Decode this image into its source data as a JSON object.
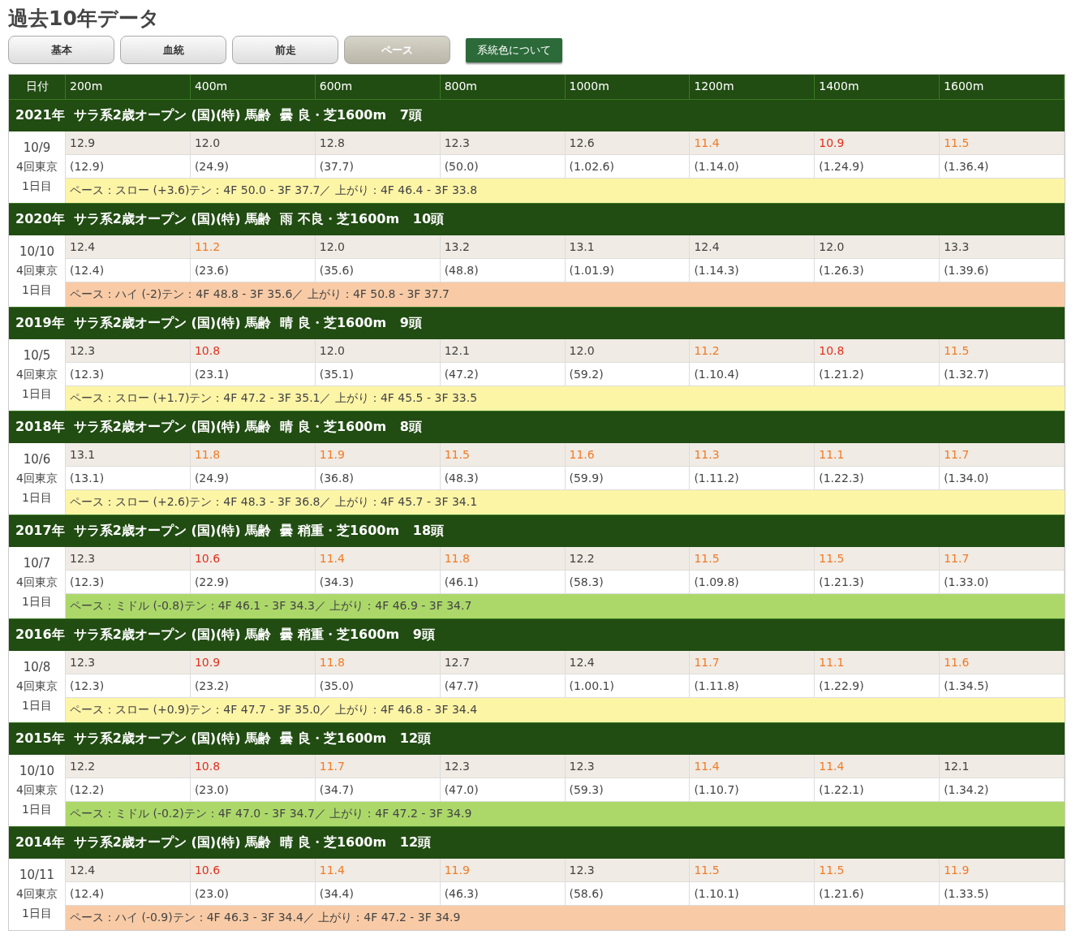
{
  "title": "過去10年データ",
  "tabs": [
    {
      "label": "基本",
      "selected": false
    },
    {
      "label": "血統",
      "selected": false
    },
    {
      "label": "前走",
      "selected": false
    },
    {
      "label": "ペース",
      "selected": true
    }
  ],
  "legend_button": "系統色について",
  "columns": [
    "日付",
    "200m",
    "400m",
    "600m",
    "800m",
    "1000m",
    "1200m",
    "1400m",
    "1600m"
  ],
  "races": [
    {
      "header": "2021年  サラ系2歳オープン (国)(特) 馬齢  曇 良・芝1600m   7頭",
      "date": "10/9",
      "meeting": "4回東京",
      "day": "1日目",
      "laps": [
        {
          "split": "12.9",
          "cum": "(12.9)",
          "color": "#444444"
        },
        {
          "split": "12.0",
          "cum": "(24.9)",
          "color": "#444444"
        },
        {
          "split": "12.8",
          "cum": "(37.7)",
          "color": "#444444"
        },
        {
          "split": "12.3",
          "cum": "(50.0)",
          "color": "#444444"
        },
        {
          "split": "12.6",
          "cum": "(1.02.6)",
          "color": "#444444"
        },
        {
          "split": "11.4",
          "cum": "(1.14.0)",
          "color": "#f07c28"
        },
        {
          "split": "10.9",
          "cum": "(1.24.9)",
          "color": "#e0301e"
        },
        {
          "split": "11.5",
          "cum": "(1.36.4)",
          "color": "#f07c28"
        }
      ],
      "pace": {
        "text": "ペース：スロー (+3.6)テン：4F 50.0 - 3F 37.7／ 上がり：4F 46.4 - 3F 33.8",
        "color": "#fdf5a6"
      }
    },
    {
      "header": "2020年  サラ系2歳オープン (国)(特) 馬齢  雨 不良・芝1600m   10頭",
      "date": "10/10",
      "meeting": "4回東京",
      "day": "1日目",
      "laps": [
        {
          "split": "12.4",
          "cum": "(12.4)",
          "color": "#444444"
        },
        {
          "split": "11.2",
          "cum": "(23.6)",
          "color": "#f07c28"
        },
        {
          "split": "12.0",
          "cum": "(35.6)",
          "color": "#444444"
        },
        {
          "split": "13.2",
          "cum": "(48.8)",
          "color": "#444444"
        },
        {
          "split": "13.1",
          "cum": "(1.01.9)",
          "color": "#444444"
        },
        {
          "split": "12.4",
          "cum": "(1.14.3)",
          "color": "#444444"
        },
        {
          "split": "12.0",
          "cum": "(1.26.3)",
          "color": "#444444"
        },
        {
          "split": "13.3",
          "cum": "(1.39.6)",
          "color": "#444444"
        }
      ],
      "pace": {
        "text": "ペース：ハイ (-2)テン：4F 48.8 - 3F 35.6／ 上がり：4F 50.8 - 3F 37.7",
        "color": "#f8cba6"
      }
    },
    {
      "header": "2019年  サラ系2歳オープン (国)(特) 馬齢  晴 良・芝1600m   9頭",
      "date": "10/5",
      "meeting": "4回東京",
      "day": "1日目",
      "laps": [
        {
          "split": "12.3",
          "cum": "(12.3)",
          "color": "#444444"
        },
        {
          "split": "10.8",
          "cum": "(23.1)",
          "color": "#e0301e"
        },
        {
          "split": "12.0",
          "cum": "(35.1)",
          "color": "#444444"
        },
        {
          "split": "12.1",
          "cum": "(47.2)",
          "color": "#444444"
        },
        {
          "split": "12.0",
          "cum": "(59.2)",
          "color": "#444444"
        },
        {
          "split": "11.2",
          "cum": "(1.10.4)",
          "color": "#f07c28"
        },
        {
          "split": "10.8",
          "cum": "(1.21.2)",
          "color": "#e0301e"
        },
        {
          "split": "11.5",
          "cum": "(1.32.7)",
          "color": "#f07c28"
        }
      ],
      "pace": {
        "text": "ペース：スロー (+1.7)テン：4F 47.2 - 3F 35.1／ 上がり：4F 45.5 - 3F 33.5",
        "color": "#fdf5a6"
      }
    },
    {
      "header": "2018年  サラ系2歳オープン (国)(特) 馬齢  晴 良・芝1600m   8頭",
      "date": "10/6",
      "meeting": "4回東京",
      "day": "1日目",
      "laps": [
        {
          "split": "13.1",
          "cum": "(13.1)",
          "color": "#444444"
        },
        {
          "split": "11.8",
          "cum": "(24.9)",
          "color": "#f07c28"
        },
        {
          "split": "11.9",
          "cum": "(36.8)",
          "color": "#f07c28"
        },
        {
          "split": "11.5",
          "cum": "(48.3)",
          "color": "#f07c28"
        },
        {
          "split": "11.6",
          "cum": "(59.9)",
          "color": "#f07c28"
        },
        {
          "split": "11.3",
          "cum": "(1.11.2)",
          "color": "#f07c28"
        },
        {
          "split": "11.1",
          "cum": "(1.22.3)",
          "color": "#f07c28"
        },
        {
          "split": "11.7",
          "cum": "(1.34.0)",
          "color": "#f07c28"
        }
      ],
      "pace": {
        "text": "ペース：スロー (+2.6)テン：4F 48.3 - 3F 36.8／ 上がり：4F 45.7 - 3F 34.1",
        "color": "#fdf5a6"
      }
    },
    {
      "header": "2017年  サラ系2歳オープン (国)(特) 馬齢  曇 稍重・芝1600m   18頭",
      "date": "10/7",
      "meeting": "4回東京",
      "day": "1日目",
      "laps": [
        {
          "split": "12.3",
          "cum": "(12.3)",
          "color": "#444444"
        },
        {
          "split": "10.6",
          "cum": "(22.9)",
          "color": "#e0301e"
        },
        {
          "split": "11.4",
          "cum": "(34.3)",
          "color": "#f07c28"
        },
        {
          "split": "11.8",
          "cum": "(46.1)",
          "color": "#f07c28"
        },
        {
          "split": "12.2",
          "cum": "(58.3)",
          "color": "#444444"
        },
        {
          "split": "11.5",
          "cum": "(1.09.8)",
          "color": "#f07c28"
        },
        {
          "split": "11.5",
          "cum": "(1.21.3)",
          "color": "#f07c28"
        },
        {
          "split": "11.7",
          "cum": "(1.33.0)",
          "color": "#f07c28"
        }
      ],
      "pace": {
        "text": "ペース：ミドル (-0.8)テン：4F 46.1 - 3F 34.3／ 上がり：4F 46.9 - 3F 34.7",
        "color": "#acd86a"
      }
    },
    {
      "header": "2016年  サラ系2歳オープン (国)(特) 馬齢  曇 稍重・芝1600m   9頭",
      "date": "10/8",
      "meeting": "4回東京",
      "day": "1日目",
      "laps": [
        {
          "split": "12.3",
          "cum": "(12.3)",
          "color": "#444444"
        },
        {
          "split": "10.9",
          "cum": "(23.2)",
          "color": "#e0301e"
        },
        {
          "split": "11.8",
          "cum": "(35.0)",
          "color": "#f07c28"
        },
        {
          "split": "12.7",
          "cum": "(47.7)",
          "color": "#444444"
        },
        {
          "split": "12.4",
          "cum": "(1.00.1)",
          "color": "#444444"
        },
        {
          "split": "11.7",
          "cum": "(1.11.8)",
          "color": "#f07c28"
        },
        {
          "split": "11.1",
          "cum": "(1.22.9)",
          "color": "#f07c28"
        },
        {
          "split": "11.6",
          "cum": "(1.34.5)",
          "color": "#f07c28"
        }
      ],
      "pace": {
        "text": "ペース：スロー (+0.9)テン：4F 47.7 - 3F 35.0／ 上がり：4F 46.8 - 3F 34.4",
        "color": "#fdf5a6"
      }
    },
    {
      "header": "2015年  サラ系2歳オープン (国)(特) 馬齢  曇 良・芝1600m   12頭",
      "date": "10/10",
      "meeting": "4回東京",
      "day": "1日目",
      "laps": [
        {
          "split": "12.2",
          "cum": "(12.2)",
          "color": "#444444"
        },
        {
          "split": "10.8",
          "cum": "(23.0)",
          "color": "#e0301e"
        },
        {
          "split": "11.7",
          "cum": "(34.7)",
          "color": "#f07c28"
        },
        {
          "split": "12.3",
          "cum": "(47.0)",
          "color": "#444444"
        },
        {
          "split": "12.3",
          "cum": "(59.3)",
          "color": "#444444"
        },
        {
          "split": "11.4",
          "cum": "(1.10.7)",
          "color": "#f07c28"
        },
        {
          "split": "11.4",
          "cum": "(1.22.1)",
          "color": "#f07c28"
        },
        {
          "split": "12.1",
          "cum": "(1.34.2)",
          "color": "#444444"
        }
      ],
      "pace": {
        "text": "ペース：ミドル (-0.2)テン：4F 47.0 - 3F 34.7／ 上がり：4F 47.2 - 3F 34.9",
        "color": "#acd86a"
      }
    },
    {
      "header": "2014年  サラ系2歳オープン (国)(特) 馬齢  晴 良・芝1600m   12頭",
      "date": "10/11",
      "meeting": "4回東京",
      "day": "1日目",
      "laps": [
        {
          "split": "12.4",
          "cum": "(12.4)",
          "color": "#444444"
        },
        {
          "split": "10.6",
          "cum": "(23.0)",
          "color": "#e0301e"
        },
        {
          "split": "11.4",
          "cum": "(34.4)",
          "color": "#f07c28"
        },
        {
          "split": "11.9",
          "cum": "(46.3)",
          "color": "#f07c28"
        },
        {
          "split": "12.3",
          "cum": "(58.6)",
          "color": "#444444"
        },
        {
          "split": "11.5",
          "cum": "(1.10.1)",
          "color": "#f07c28"
        },
        {
          "split": "11.5",
          "cum": "(1.21.6)",
          "color": "#f07c28"
        },
        {
          "split": "11.9",
          "cum": "(1.33.5)",
          "color": "#f07c28"
        }
      ],
      "pace": {
        "text": "ペース：ハイ (-0.9)テン：4F 46.3 - 3F 34.4／ 上がり：4F 47.2 - 3F 34.9",
        "color": "#f8cba6"
      }
    }
  ]
}
